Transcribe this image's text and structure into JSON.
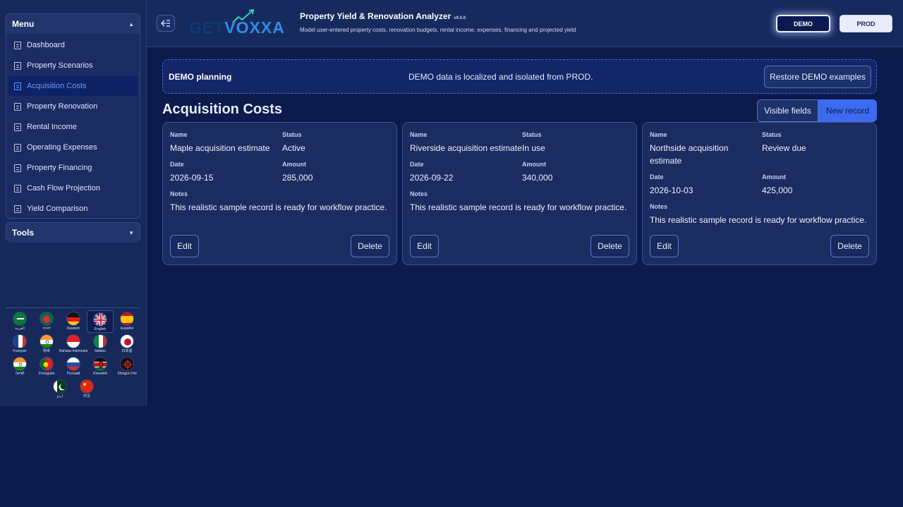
{
  "sidebar": {
    "menu_title": "Menu",
    "tools_title": "Tools",
    "items": [
      {
        "label": "Dashboard",
        "active": false
      },
      {
        "label": "Property Scenarios",
        "active": false
      },
      {
        "label": "Acquisition Costs",
        "active": true
      },
      {
        "label": "Property Renovation",
        "active": false
      },
      {
        "label": "Rental Income",
        "active": false
      },
      {
        "label": "Operating Expenses",
        "active": false
      },
      {
        "label": "Property Financing",
        "active": false
      },
      {
        "label": "Cash Flow Projection",
        "active": false
      },
      {
        "label": "Yield Comparison",
        "active": false
      }
    ],
    "languages": [
      {
        "label": "العربية",
        "flag": "saudi-arabia"
      },
      {
        "label": "বাংলা",
        "flag": "bangladesh"
      },
      {
        "label": "Deutsch",
        "flag": "germany"
      },
      {
        "label": "English",
        "flag": "uk",
        "selected": true
      },
      {
        "label": "Español",
        "flag": "spain"
      },
      {
        "label": "Français",
        "flag": "france"
      },
      {
        "label": "हिन्दी",
        "flag": "india"
      },
      {
        "label": "Bahasa Indonesia",
        "flag": "indonesia"
      },
      {
        "label": "Italiano",
        "flag": "italy"
      },
      {
        "label": "日本語",
        "flag": "japan"
      },
      {
        "label": "ਪੰਜਾਬੀ",
        "flag": "india"
      },
      {
        "label": "Português",
        "flag": "portugal"
      },
      {
        "label": "Русский",
        "flag": "russia"
      },
      {
        "label": "Kiswahili",
        "flag": "kenya"
      },
      {
        "label": "Shingon Hol",
        "flag": "shingon"
      },
      {
        "label": "اردو",
        "flag": "pakistan"
      },
      {
        "label": "中文",
        "flag": "china"
      }
    ]
  },
  "header": {
    "logo_get": "GET",
    "logo_vox": "VOXXA",
    "title": "Property Yield & Renovation Analyzer",
    "version": "v9.0.0",
    "subtitle": "Model user-entered property costs, renovation budgets, rental income, expenses, financing and projected yield",
    "env_demo": "DEMO",
    "env_prod": "PROD"
  },
  "banner": {
    "title": "DEMO planning",
    "message": "DEMO data is localized and isolated from PROD.",
    "restore_label": "Restore DEMO examples"
  },
  "section": {
    "title": "Acquisition Costs",
    "visible_fields_label": "Visible fields",
    "new_record_label": "New record"
  },
  "labels": {
    "name": "Name",
    "status": "Status",
    "date": "Date",
    "amount": "Amount",
    "notes": "Notes",
    "edit": "Edit",
    "delete": "Delete"
  },
  "records": [
    {
      "name": "Maple acquisition estimate",
      "status": "Active",
      "date": "2026-09-15",
      "amount": "285,000",
      "notes": "This realistic sample record is ready for workflow practice."
    },
    {
      "name": "Riverside acquisition estimate",
      "status": "In use",
      "date": "2026-09-22",
      "amount": "340,000",
      "notes": "This realistic sample record is ready for workflow practice."
    },
    {
      "name": "Northside acquisition estimate",
      "status": "Review due",
      "date": "2026-10-03",
      "amount": "425,000",
      "notes": "This realistic sample record is ready for workflow practice."
    }
  ],
  "colors": {
    "background": "#0c1b4b",
    "accent": "#3c6bf0",
    "active_menu_text": "#5f9cff"
  }
}
